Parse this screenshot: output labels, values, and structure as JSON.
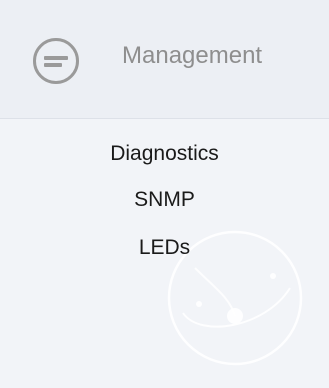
{
  "header": {
    "title": "Management",
    "icon": "menu-lines-icon"
  },
  "nav": {
    "items": [
      {
        "label": "Diagnostics"
      },
      {
        "label": "SNMP"
      },
      {
        "label": "LEDs"
      }
    ]
  },
  "colors": {
    "background": "#f2f4f8",
    "header_background": "#eceff4",
    "header_text": "#8e8e8e",
    "icon_stroke": "#9a9a9a",
    "nav_text": "#1a1a1a"
  }
}
